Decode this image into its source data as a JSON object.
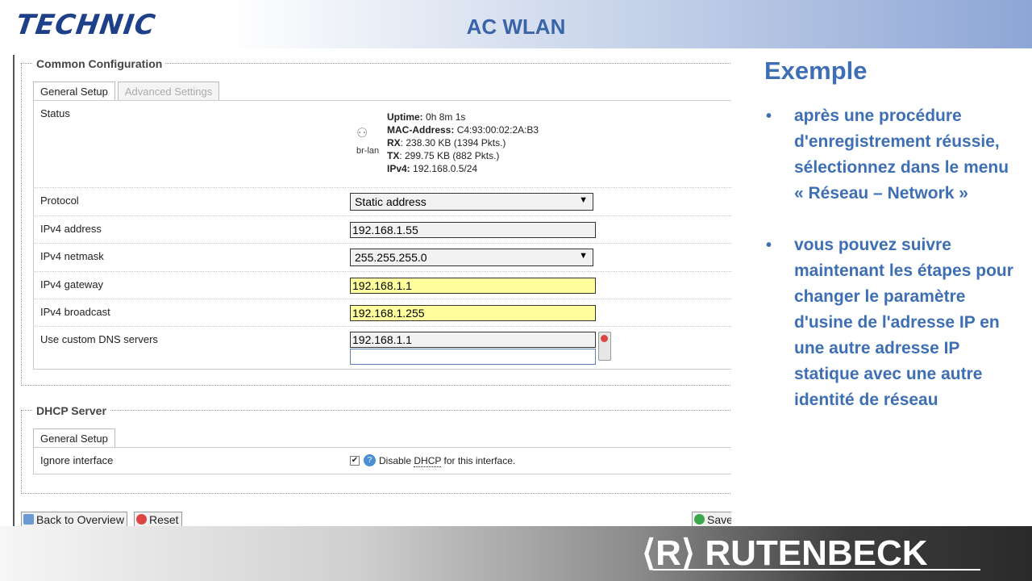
{
  "header": {
    "logo": "TECHNIC",
    "title": "AC WLAN"
  },
  "common": {
    "legend": "Common Configuration",
    "tabs": [
      "General Setup",
      "Advanced Settings"
    ],
    "status": {
      "label": "Status",
      "interface": "br-lan",
      "uptime_label": "Uptime:",
      "uptime": "0h 8m 1s",
      "mac_label": "MAC-Address:",
      "mac": "C4:93:00:02:2A:B3",
      "rx_label": "RX",
      "rx": ": 238.30 KB (1394 Pkts.)",
      "tx_label": "TX",
      "tx": ": 299.75 KB (882 Pkts.)",
      "ipv4_label": "IPv4:",
      "ipv4": "192.168.0.5/24"
    },
    "fields": {
      "protocol": {
        "label": "Protocol",
        "value": "Static address"
      },
      "ipv4_address": {
        "label": "IPv4 address",
        "value": "192.168.1.55"
      },
      "ipv4_netmask": {
        "label": "IPv4 netmask",
        "value": "255.255.255.0"
      },
      "ipv4_gateway": {
        "label": "IPv4 gateway",
        "value": "192.168.1.1"
      },
      "ipv4_broadcast": {
        "label": "IPv4 broadcast",
        "value": "192.168.1.255"
      },
      "dns": {
        "label": "Use custom DNS servers",
        "value": "192.168.1.1",
        "value2": ""
      }
    }
  },
  "dhcp": {
    "legend": "DHCP Server",
    "tab": "General Setup",
    "ignore_label": "Ignore interface",
    "checkbox_mark": "✔",
    "help_glyph": "?",
    "hint_prefix": "Disable ",
    "hint_abbr": "DHCP",
    "hint_suffix": " for this interface."
  },
  "buttons": {
    "back": "Back to Overview",
    "reset": "Reset",
    "save": "Save"
  },
  "right": {
    "heading": "Exemple",
    "bullets": [
      "après une procédure d'enregistrement réussie, sélectionnez dans le menu « Réseau – Network »",
      "vous pouvez suivre maintenant les étapes pour changer le paramètre d'usine de l'adresse IP en une autre adresse IP statique avec une autre identité de réseau"
    ]
  },
  "footer": {
    "brand": "⟨R⟩ RUTENBECK"
  },
  "icons": {
    "select_arrow": "▼",
    "network_icon": "⚇"
  }
}
